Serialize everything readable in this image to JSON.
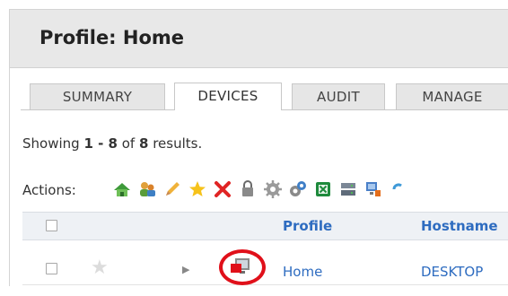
{
  "header": {
    "title": "Profile: Home"
  },
  "tabs": [
    {
      "label": "SUMMARY",
      "active": false
    },
    {
      "label": "DEVICES",
      "active": true
    },
    {
      "label": "AUDIT",
      "active": false
    },
    {
      "label": "MANAGE",
      "active": false
    }
  ],
  "results": {
    "prefix": "Showing ",
    "range": "1 - 8",
    "middle": " of ",
    "total": "8",
    "suffix": " results."
  },
  "actions": {
    "label": "Actions:",
    "icons": [
      "home-add-icon",
      "user-group-add-icon",
      "pencil-edit-icon",
      "star-icon",
      "delete-x-icon",
      "lock-icon",
      "gear-icon",
      "gears-icon",
      "excel-export-icon",
      "server-icon",
      "computer-export-icon"
    ]
  },
  "table": {
    "columns": [
      "",
      "",
      "",
      "Profile",
      "Hostname"
    ],
    "rows": [
      {
        "checked": false,
        "starred": false,
        "device_icon": "computer-warning-icon",
        "profile": "Home",
        "hostname": "DESKTOP"
      }
    ]
  },
  "colors": {
    "link": "#2e6cc0",
    "highlight": "#e0101a",
    "header_bg": "#e8e8e8"
  }
}
